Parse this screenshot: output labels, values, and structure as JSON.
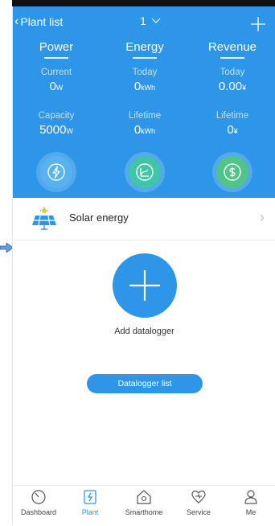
{
  "nav": {
    "back_label": "Plant list",
    "plant_number": "1"
  },
  "tabs": {
    "power": "Power",
    "energy": "Energy",
    "revenue": "Revenue"
  },
  "stats": {
    "current": {
      "label": "Current",
      "value": "0",
      "unit": "W"
    },
    "energy_today": {
      "label": "Today",
      "value": "0",
      "unit": "kWh"
    },
    "revenue_today": {
      "label": "Today",
      "value": "0.00",
      "unit": "¥"
    },
    "capacity": {
      "label": "Capacity",
      "value": "5000",
      "unit": "W"
    },
    "energy_lifetime": {
      "label": "Lifetime",
      "value": "0",
      "unit": "kWh"
    },
    "revenue_lifetime": {
      "label": "Lifetime",
      "value": "0",
      "unit": "¥"
    }
  },
  "solar": {
    "label": "Solar energy"
  },
  "main": {
    "add_label": "Add datalogger",
    "list_button": "Datalogger list"
  },
  "bottom_nav": {
    "items": [
      {
        "label": "Dashboard",
        "icon": "dashboard-icon"
      },
      {
        "label": "Plant",
        "icon": "plant-icon"
      },
      {
        "label": "Smarthome",
        "icon": "smarthome-icon"
      },
      {
        "label": "Service",
        "icon": "service-icon"
      },
      {
        "label": "Me",
        "icon": "me-icon"
      }
    ],
    "active": "Plant"
  },
  "colors": {
    "primary": "#2e96e8",
    "power_circle": "#58b2ef",
    "energy_circle": "#3fc6a6",
    "revenue_circle": "#52c487"
  }
}
